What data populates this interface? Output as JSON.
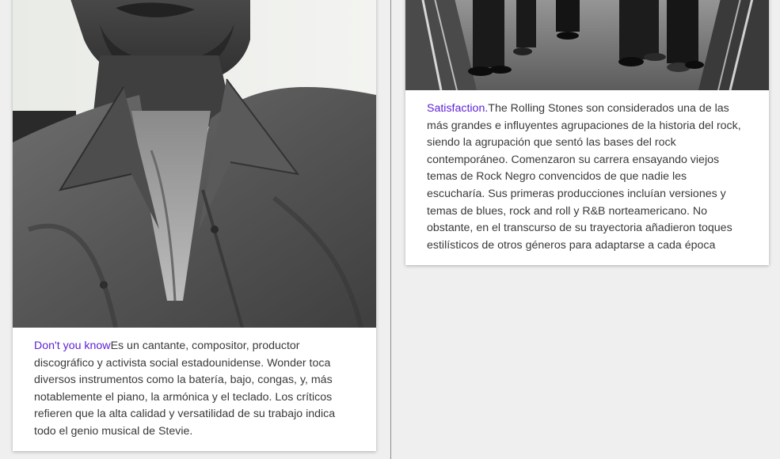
{
  "cards": [
    {
      "image_alt": "Black and white portrait of Stevie Wonder",
      "link_label": "Don't you know",
      "description": "Es un cantante, compositor, productor discográfico y activista social estadounidense. Wonder toca diversos instrumentos como la batería, bajo, congas, y, más notablemente el piano, la armónica y el teclado. Los críticos refieren que la alta calidad y versatilidad de su trabajo indica todo el genio musical de Stevie."
    },
    {
      "image_alt": "The Rolling Stones standing in a hallway",
      "link_label": "Satisfaction.",
      "description": "The Rolling Stones son considerados una de las más grandes e influyentes agrupaciones de la historia del rock, siendo la agrupación que sentó las bases del rock contemporáneo. Comenzaron su carrera ensayando viejos temas de Rock Negro convencidos de que nadie les escucharía. Sus primeras producciones incluían versiones y temas de blues, rock and roll y R&B norteamericano. No obstante, en el transcurso de su trayectoria añadieron toques estilísticos de otros géneros para adaptarse a cada época"
    }
  ],
  "colors": {
    "link": "#5b1fd6",
    "text": "#3a3a3a",
    "background": "#efefef",
    "card": "#ffffff"
  }
}
